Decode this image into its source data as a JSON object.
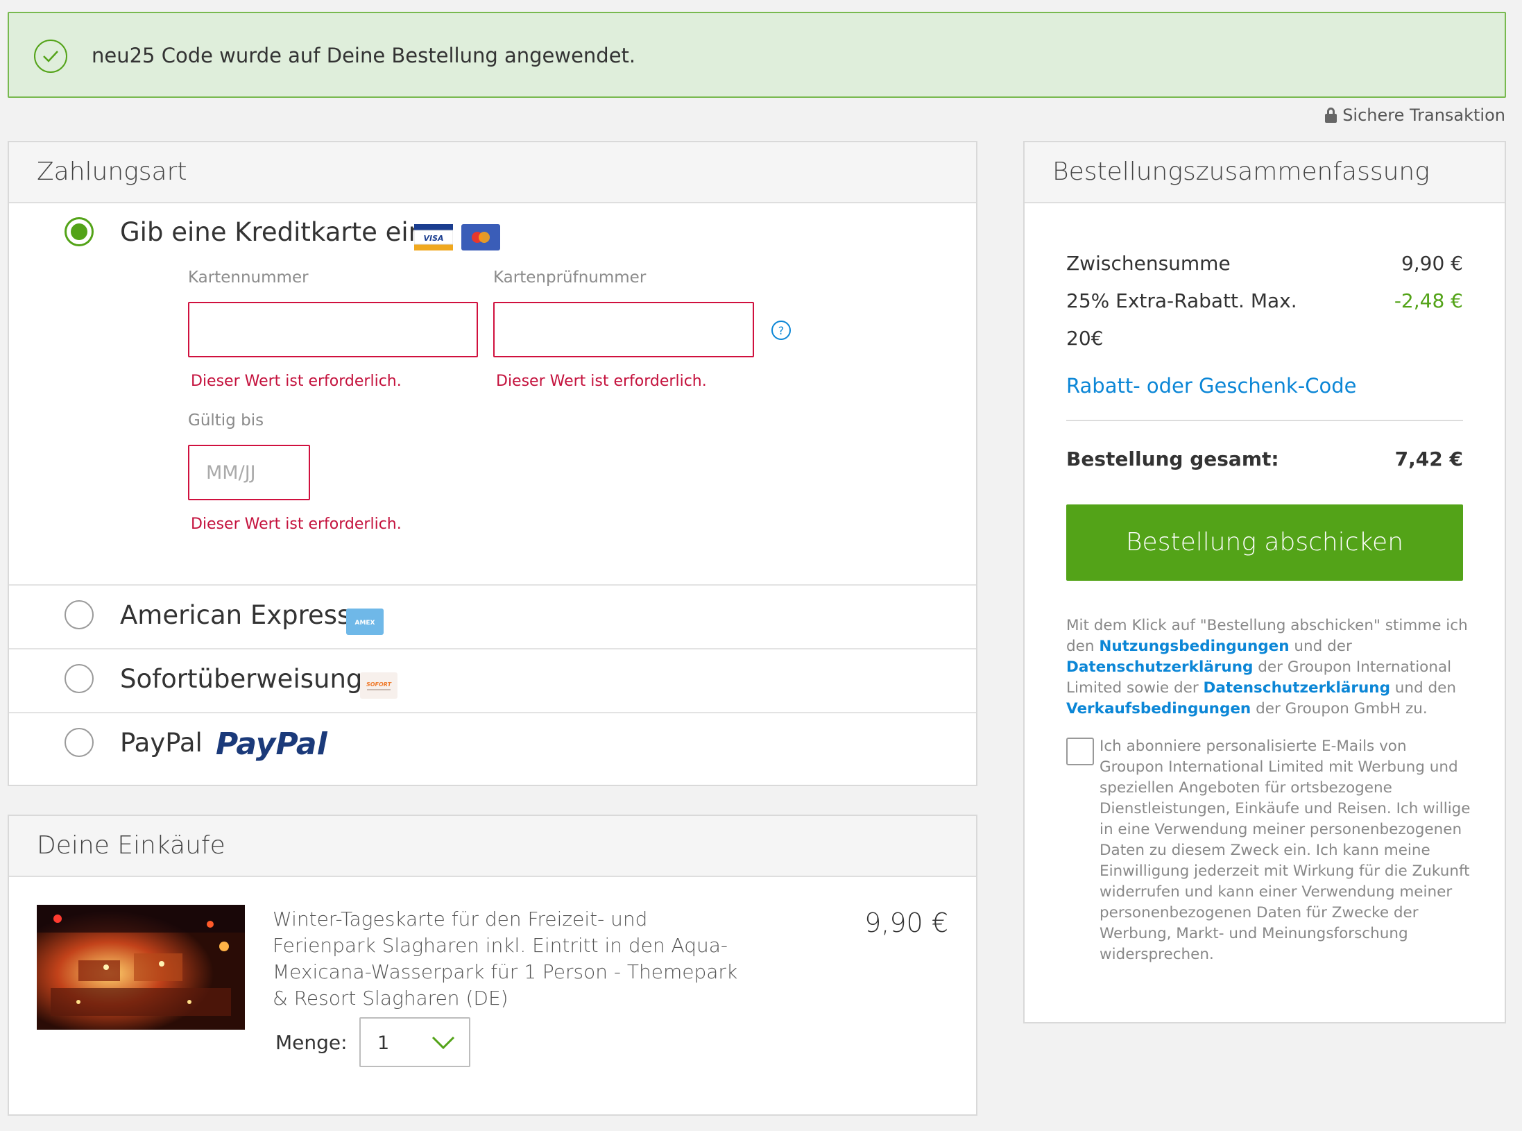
{
  "banner": {
    "message": "neu25 Code wurde auf Deine Bestellung angewendet."
  },
  "secure": {
    "label": "Sichere Transaktion"
  },
  "payment": {
    "title": "Zahlungsart",
    "credit_card": {
      "label": "Gib eine Kreditkarte ein",
      "card_number_label": "Kartennummer",
      "cvc_label": "Kartenprüfnummer",
      "expiry_label": "Gültig bis",
      "expiry_placeholder": "MM/JJ",
      "error": "Dieser Wert ist erforderlich."
    },
    "options": [
      {
        "label": "American Express",
        "logo": "AMEX"
      },
      {
        "label": "Sofortüberweisung",
        "logo": "SOFORT"
      },
      {
        "label": "PayPal",
        "logo": "PayPal"
      }
    ]
  },
  "summary": {
    "title": "Bestellungszusammenfassung",
    "subtotal_label": "Zwischensumme",
    "subtotal_value": "9,90 €",
    "discount_label_line1": "25% Extra-Rabatt. Max.",
    "discount_label_line2": "20€",
    "discount_value": "-2,48 €",
    "code_link": "Rabatt- oder Geschenk-Code",
    "total_label": "Bestellung gesamt:",
    "total_value": "7,42 €",
    "submit_label": "Bestellung abschicken",
    "legal": {
      "part1": "Mit dem Klick auf \"Bestellung abschicken\" stimme ich den ",
      "link1": "Nutzungsbedingungen",
      "part2": " und der ",
      "link2": "Datenschutzerklärung",
      "part3": " der Groupon International Limited sowie der ",
      "link3": "Datenschutzerklärung",
      "part4": " und den ",
      "link4": "Verkaufsbedingungen",
      "part5": " der Groupon GmbH zu."
    },
    "subscribe_text": "Ich abonniere personalisierte E-Mails von Groupon International Limited mit Werbung und speziellen Angeboten für ortsbezogene Dienstleistungen, Einkäufe und Reisen. Ich willige in eine Verwendung meiner personenbezogenen Daten zu diesem Zweck ein. Ich kann meine Einwilligung jederzeit mit Wirkung für die Zukunft widerrufen und kann einer Verwendung meiner personenbezogenen Daten für Zwecke der Werbung, Markt- und Meinungsforschung widersprechen."
  },
  "cart": {
    "title": "Deine Einkäufe",
    "item": {
      "title": "Winter-Tageskarte für den Freizeit- und Ferienpark Slagharen inkl. Eintritt in den Aqua-Mexicana-Wasserpark für 1 Person - Themepark & Resort Slagharen (DE)",
      "price": "9,90 €",
      "qty_label": "Menge:",
      "qty_value": "1"
    }
  },
  "colors": {
    "accent_green": "#53a318",
    "error_red": "#c4123d",
    "link_blue": "#0b86d6",
    "banner_bg": "#dfeedb"
  }
}
